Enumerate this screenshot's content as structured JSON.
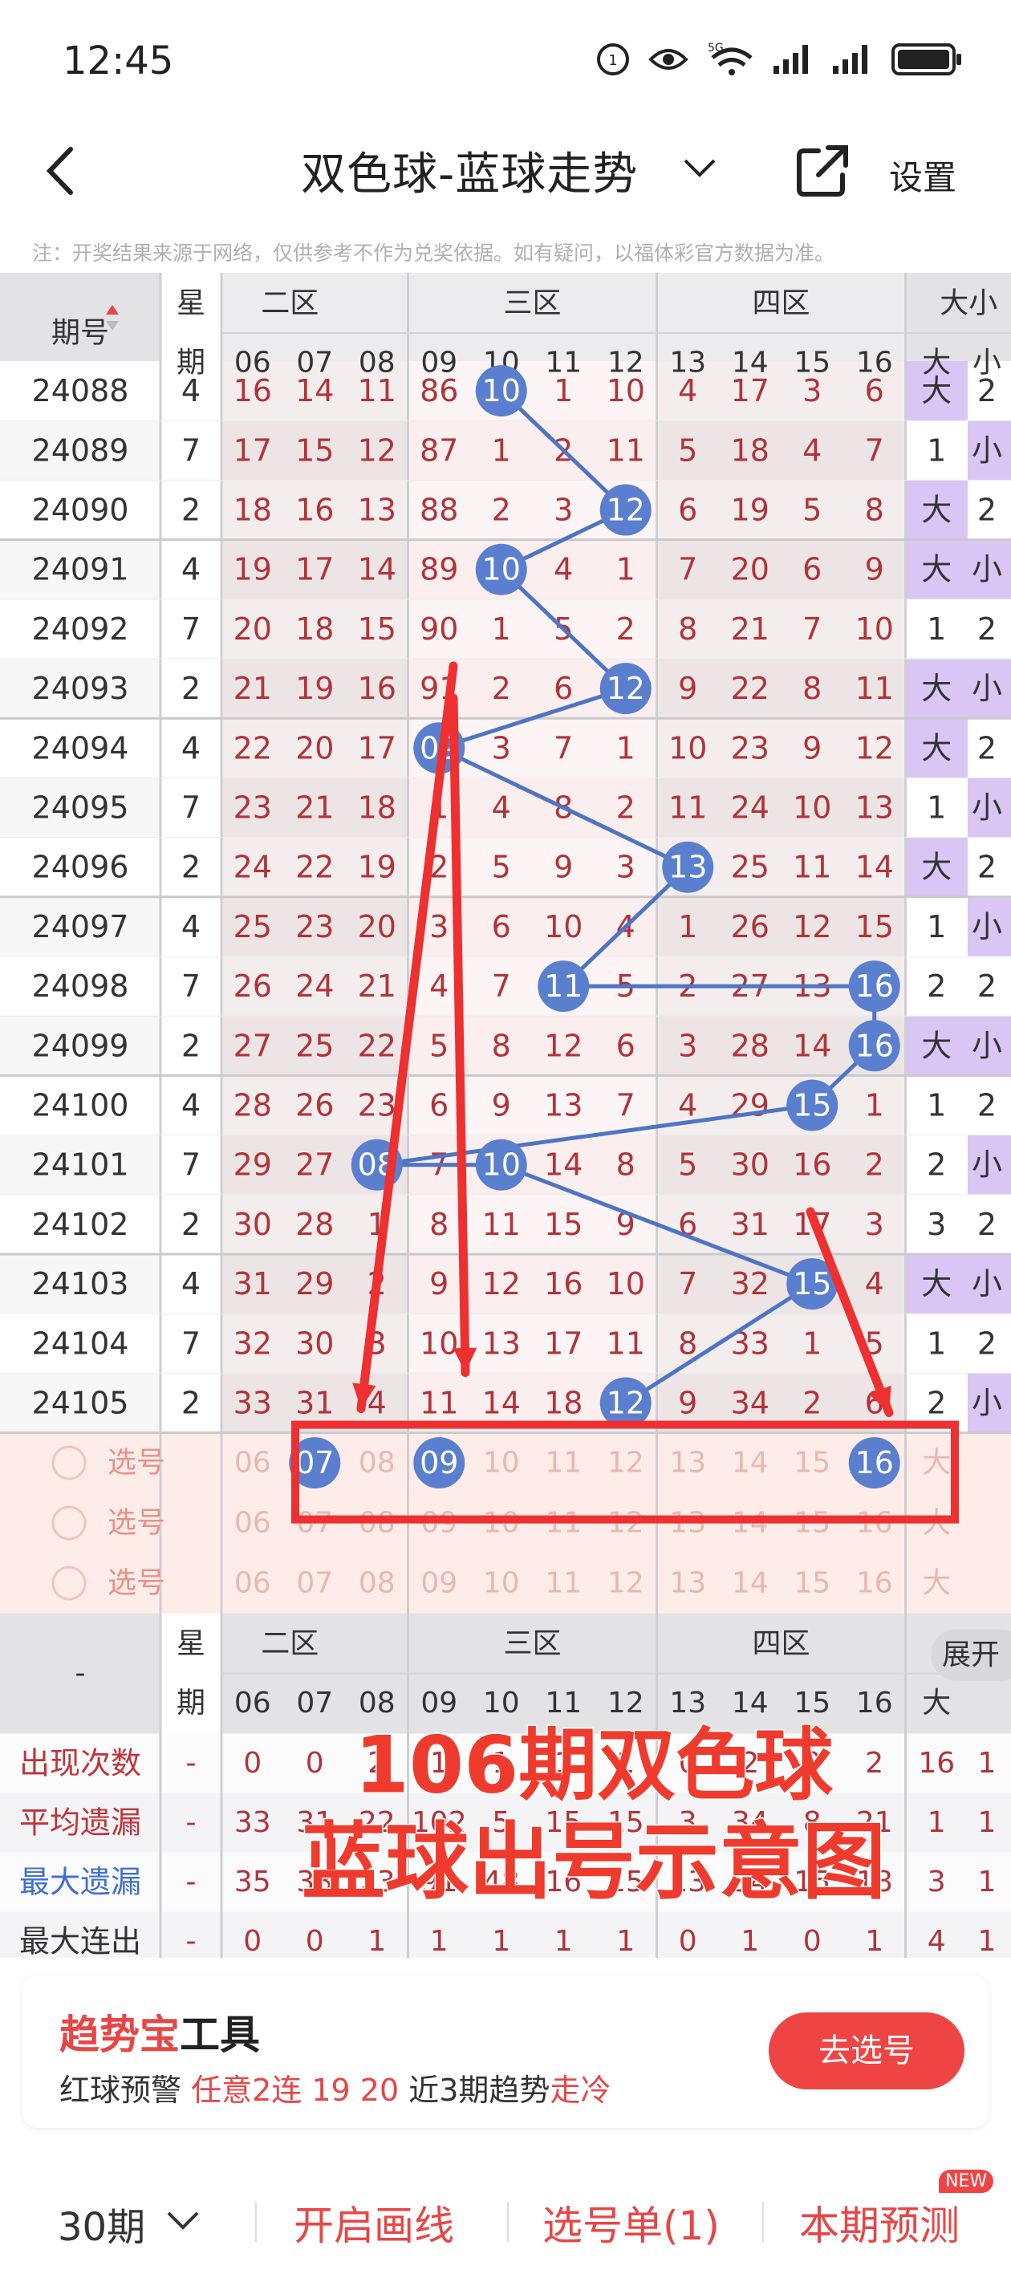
{
  "status_bar": {
    "time": "12:45",
    "network_label": "5G"
  },
  "nav": {
    "title": "双色球-蓝球走势",
    "settings": "设置"
  },
  "notice": "注：开奖结果来源于网络，仅供参考不作为兑奖依据。如有疑问，以福体彩官方数据为准。",
  "table": {
    "issue_header": "期号",
    "week_header_1": "星",
    "week_header_2": "期",
    "zones": [
      "二区",
      "三区",
      "四区"
    ],
    "size_header": "大小",
    "size_big": "大",
    "size_small": "小",
    "columns": [
      "06",
      "07",
      "08",
      "09",
      "10",
      "11",
      "12",
      "13",
      "14",
      "15",
      "16"
    ],
    "rows": [
      {
        "issue": "24088",
        "week": "4",
        "cells": [
          "16",
          "14",
          "11",
          "86",
          "10",
          "1",
          "10",
          "4",
          "17",
          "3",
          "6"
        ],
        "size": "大"
      },
      {
        "issue": "24089",
        "week": "7",
        "cells": [
          "17",
          "15",
          "12",
          "87",
          "1",
          "2",
          "11",
          "5",
          "18",
          "4",
          "7"
        ],
        "size": "1"
      },
      {
        "issue": "24090",
        "week": "2",
        "cells": [
          "18",
          "16",
          "13",
          "88",
          "2",
          "3",
          "12",
          "6",
          "19",
          "5",
          "8"
        ],
        "size": "大"
      },
      {
        "issue": "24091",
        "week": "4",
        "cells": [
          "19",
          "17",
          "14",
          "89",
          "10",
          "4",
          "1",
          "7",
          "20",
          "6",
          "9"
        ],
        "size": "大"
      },
      {
        "issue": "24092",
        "week": "7",
        "cells": [
          "20",
          "18",
          "15",
          "90",
          "1",
          "5",
          "2",
          "8",
          "21",
          "7",
          "10"
        ],
        "size": "1"
      },
      {
        "issue": "24093",
        "week": "2",
        "cells": [
          "21",
          "19",
          "16",
          "91",
          "2",
          "6",
          "12",
          "9",
          "22",
          "8",
          "11"
        ],
        "size": "大"
      },
      {
        "issue": "24094",
        "week": "4",
        "cells": [
          "22",
          "20",
          "17",
          "09",
          "3",
          "7",
          "1",
          "10",
          "23",
          "9",
          "12"
        ],
        "size": "大"
      },
      {
        "issue": "24095",
        "week": "7",
        "cells": [
          "23",
          "21",
          "18",
          "1",
          "4",
          "8",
          "2",
          "11",
          "24",
          "10",
          "13"
        ],
        "size": "1"
      },
      {
        "issue": "24096",
        "week": "2",
        "cells": [
          "24",
          "22",
          "19",
          "2",
          "5",
          "9",
          "3",
          "13",
          "25",
          "11",
          "14"
        ],
        "size": "大"
      },
      {
        "issue": "24097",
        "week": "4",
        "cells": [
          "25",
          "23",
          "20",
          "3",
          "6",
          "10",
          "4",
          "1",
          "26",
          "12",
          "15"
        ],
        "size": "1"
      },
      {
        "issue": "24098",
        "week": "7",
        "cells": [
          "26",
          "24",
          "21",
          "4",
          "7",
          "11",
          "5",
          "2",
          "27",
          "13",
          "16"
        ],
        "size": "2"
      },
      {
        "issue": "24099",
        "week": "2",
        "cells": [
          "27",
          "25",
          "22",
          "5",
          "8",
          "12",
          "6",
          "3",
          "28",
          "14",
          "16"
        ],
        "size": "大"
      },
      {
        "issue": "24100",
        "week": "4",
        "cells": [
          "28",
          "26",
          "23",
          "6",
          "9",
          "13",
          "7",
          "4",
          "29",
          "15",
          "1"
        ],
        "size": "1"
      },
      {
        "issue": "24101",
        "week": "7",
        "cells": [
          "29",
          "27",
          "08",
          "7",
          "10",
          "14",
          "8",
          "5",
          "30",
          "16",
          "2"
        ],
        "size": "2"
      },
      {
        "issue": "24102",
        "week": "2",
        "cells": [
          "30",
          "28",
          "1",
          "8",
          "11",
          "15",
          "9",
          "6",
          "31",
          "17",
          "3"
        ],
        "size": "3"
      },
      {
        "issue": "24103",
        "week": "4",
        "cells": [
          "31",
          "29",
          "2",
          "9",
          "12",
          "16",
          "10",
          "7",
          "32",
          "15",
          "4"
        ],
        "size": "大"
      },
      {
        "issue": "24104",
        "week": "7",
        "cells": [
          "32",
          "30",
          "3",
          "10",
          "13",
          "17",
          "11",
          "8",
          "33",
          "1",
          "5"
        ],
        "size": "1"
      },
      {
        "issue": "24105",
        "week": "2",
        "cells": [
          "33",
          "31",
          "4",
          "11",
          "14",
          "18",
          "12",
          "9",
          "34",
          "2",
          "6"
        ],
        "size": "2"
      }
    ],
    "select_label": "选号",
    "select_row_nums": [
      "06",
      "07",
      "08",
      "09",
      "10",
      "11",
      "12",
      "13",
      "14",
      "15",
      "16"
    ],
    "expand": "展开",
    "stats_dash": "-",
    "stats": [
      {
        "label": "出现次数",
        "dash": "-",
        "cells": [
          "0",
          "0",
          "2",
          "1",
          "1",
          "1",
          "1",
          "0",
          "2",
          "0",
          "2"
        ],
        "big": "16",
        "small": "1"
      },
      {
        "label": "平均遗漏",
        "dash": "-",
        "cells": [
          "33",
          "31",
          "22",
          "102",
          "5",
          "15",
          "15",
          "3",
          "34",
          "8",
          "21"
        ],
        "big": "1",
        "small": "1"
      },
      {
        "label": "最大遗漏",
        "dash": "-",
        "cells": [
          "35",
          "33",
          "23",
          "91",
          "48",
          "16",
          "15",
          "13",
          "34",
          "15",
          "18"
        ],
        "big": "3",
        "small": "1"
      },
      {
        "label": "最大连出",
        "dash": "-",
        "cells": [
          "0",
          "0",
          "1",
          "1",
          "1",
          "1",
          "1",
          "0",
          "1",
          "0",
          "1"
        ],
        "big": "4",
        "small": "1"
      }
    ]
  },
  "overlay": {
    "line1": "106期双色球",
    "line2": "蓝球出号示意图"
  },
  "promo": {
    "brand": "趋势宝",
    "tool": "工具",
    "prefix": "红球预警",
    "highlight": "任意2连 19 20",
    "mid": "近3期趋势",
    "trend": "走冷",
    "button": "去选号"
  },
  "bottom": {
    "period": "30期",
    "draw": "开启画线",
    "list": "选号单(1)",
    "predict": "本期预测",
    "new_badge": "NEW"
  },
  "colors": {
    "ball": "#5b7fcf",
    "accent": "#e84545",
    "big_bg": "#d9c6f5",
    "line_red": "#ee3030"
  }
}
